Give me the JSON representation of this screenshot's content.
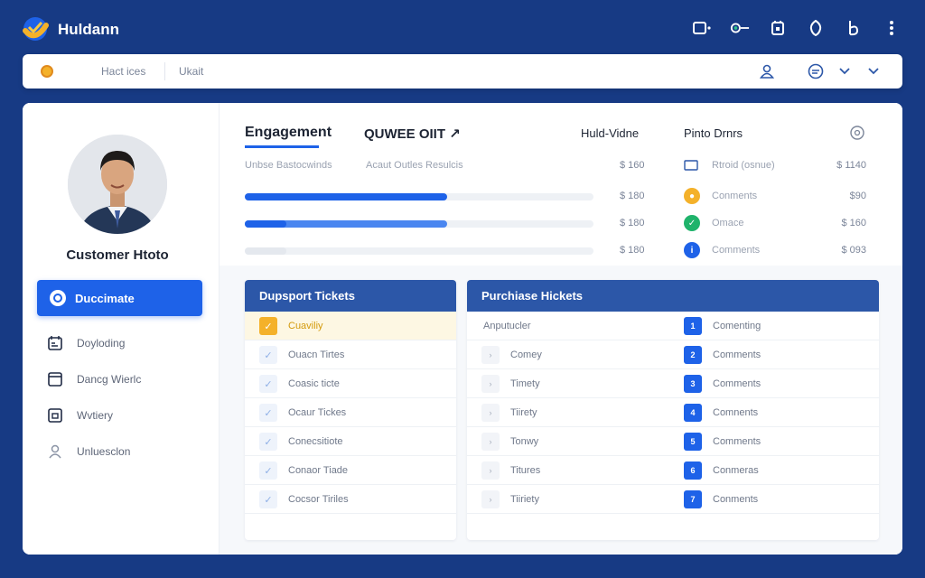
{
  "app": {
    "title": "Huldann"
  },
  "icons": {
    "logo": "logo-icon",
    "top": [
      "window-icon",
      "link-icon",
      "calendar-icon",
      "shield-icon",
      "b-icon",
      "more-icon"
    ],
    "search": [
      "profile-icon",
      "chat-icon",
      "chevron-down-icon",
      "chevron-down-icon"
    ]
  },
  "colors": {
    "accent": "#1e62e8",
    "background": "#173a84",
    "panel_header": "#2c57a8",
    "highlight": "#f4b12a"
  },
  "searchbar": {
    "tab1": "Hact ices",
    "tab2": "Ukait"
  },
  "sidebar": {
    "profile_name": "Customer Htoto",
    "active": "Duccimate",
    "items": [
      {
        "label": "Doyloding",
        "icon": "calendar-icon"
      },
      {
        "label": "Dancg Wierlc",
        "icon": "document-icon"
      },
      {
        "label": "Wvtiery",
        "icon": "window-icon"
      },
      {
        "label": "Unluesclon",
        "icon": "user-icon"
      }
    ]
  },
  "header": {
    "tab_active": "Engagement",
    "tab_second": "QUWEE OIIT ↗",
    "col_a": "Huld-Vidne",
    "col_b": "Pinto Drnrs"
  },
  "engagement": {
    "sub_a": "Unbse  Bastocwinds",
    "sub_b": "Acaut  Outles Resulcis",
    "sub_value": "$ 160",
    "bars": [
      {
        "value_label": "$ 180",
        "fill": 0.58,
        "color": "#1e62e8"
      },
      {
        "value_label": "$ 180",
        "fill": 0.58,
        "color": "#4a86f0",
        "seg": 0.12
      },
      {
        "value_label": "$ 180",
        "fill": 0.12,
        "color": "#e4e8ee"
      }
    ]
  },
  "right_list": [
    {
      "label": "Rtroid (osnue)",
      "value": "$ 1140",
      "icon": "square-icon",
      "color": ""
    },
    {
      "label": "Conments",
      "value": "$90",
      "icon": "coin-icon",
      "color": "#f4b12a"
    },
    {
      "label": "Omace",
      "value": "$ 160",
      "icon": "check-icon",
      "color": "#1fb36b"
    },
    {
      "label": "Comments",
      "value": "$ 093",
      "icon": "info-icon",
      "color": "#1e62e8"
    }
  ],
  "support": {
    "title": "Dupsport Tickets",
    "rows": [
      "Cuaviliy",
      "Ouacn Tirtes",
      "Coasic ticte",
      "Ocaur Tickes",
      "Conecsitiote",
      "Conaor Tiade",
      "Cocsor Tiriles"
    ]
  },
  "purchase": {
    "title": "Purchiase Hickets",
    "head_label": "Anputucler",
    "head_right": "Comenting",
    "rows": [
      {
        "left": "Comey",
        "right": "Comments"
      },
      {
        "left": "Timety",
        "right": "Comments"
      },
      {
        "left": "Tiirety",
        "right": "Comnents"
      },
      {
        "left": "Tonwy",
        "right": "Comments"
      },
      {
        "left": "Titures",
        "right": "Conmeras"
      },
      {
        "left": "Tiiriety",
        "right": "Conments"
      }
    ]
  }
}
